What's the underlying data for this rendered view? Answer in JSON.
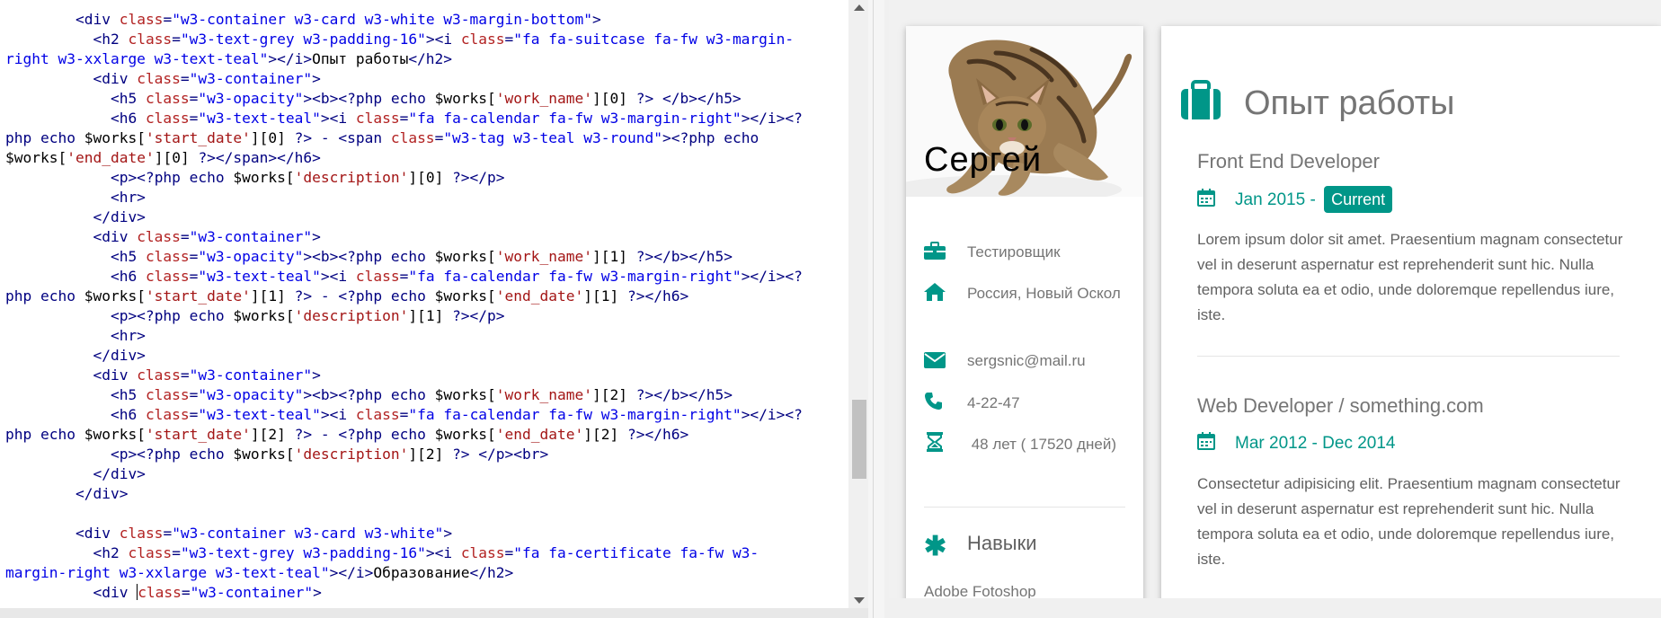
{
  "editor": {
    "lines": [
      [
        {
          "c": "t",
          "v": "        <div "
        },
        {
          "c": "a",
          "v": "class"
        },
        {
          "c": "t",
          "v": "="
        },
        {
          "c": "s",
          "v": "\"w3-container w3-card w3-white w3-margin-bottom\""
        },
        {
          "c": "t",
          "v": ">"
        }
      ],
      [
        {
          "c": "t",
          "v": "          <h2 "
        },
        {
          "c": "a",
          "v": "class"
        },
        {
          "c": "t",
          "v": "="
        },
        {
          "c": "s",
          "v": "\"w3-text-grey w3-padding-16\""
        },
        {
          "c": "t",
          "v": "><i "
        },
        {
          "c": "a",
          "v": "class"
        },
        {
          "c": "t",
          "v": "="
        },
        {
          "c": "s",
          "v": "\"fa fa-suitcase fa-fw w3-margin-"
        }
      ],
      [
        {
          "c": "s",
          "v": "right w3-xxlarge w3-text-teal\""
        },
        {
          "c": "t",
          "v": "></i>"
        },
        {
          "c": "n",
          "v": "Опыт работы"
        },
        {
          "c": "t",
          "v": "</h2>"
        }
      ],
      [
        {
          "c": "t",
          "v": "          <div "
        },
        {
          "c": "a",
          "v": "class"
        },
        {
          "c": "t",
          "v": "="
        },
        {
          "c": "s",
          "v": "\"w3-container\""
        },
        {
          "c": "t",
          "v": ">"
        }
      ],
      [
        {
          "c": "t",
          "v": "            <h5 "
        },
        {
          "c": "a",
          "v": "class"
        },
        {
          "c": "t",
          "v": "="
        },
        {
          "c": "s",
          "v": "\"w3-opacity\""
        },
        {
          "c": "t",
          "v": "><b><?"
        },
        {
          "c": "p",
          "v": "php echo"
        },
        {
          "c": "n",
          "v": " $works["
        },
        {
          "c": "q",
          "v": "'work_name'"
        },
        {
          "c": "n",
          "v": "][0] "
        },
        {
          "c": "t",
          "v": "?> </b></h5>"
        }
      ],
      [
        {
          "c": "t",
          "v": "            <h6 "
        },
        {
          "c": "a",
          "v": "class"
        },
        {
          "c": "t",
          "v": "="
        },
        {
          "c": "s",
          "v": "\"w3-text-teal\""
        },
        {
          "c": "t",
          "v": "><i "
        },
        {
          "c": "a",
          "v": "class"
        },
        {
          "c": "t",
          "v": "="
        },
        {
          "c": "s",
          "v": "\"fa fa-calendar fa-fw w3-margin-right\""
        },
        {
          "c": "t",
          "v": "></i><?"
        }
      ],
      [
        {
          "c": "p",
          "v": "php echo"
        },
        {
          "c": "n",
          "v": " $works["
        },
        {
          "c": "q",
          "v": "'start_date'"
        },
        {
          "c": "n",
          "v": "][0] "
        },
        {
          "c": "t",
          "v": "?> - <span "
        },
        {
          "c": "a",
          "v": "class"
        },
        {
          "c": "t",
          "v": "="
        },
        {
          "c": "s",
          "v": "\"w3-tag w3-teal w3-round\""
        },
        {
          "c": "t",
          "v": "><?"
        },
        {
          "c": "p",
          "v": "php echo"
        }
      ],
      [
        {
          "c": "n",
          "v": "$works["
        },
        {
          "c": "q",
          "v": "'end_date'"
        },
        {
          "c": "n",
          "v": "][0] "
        },
        {
          "c": "t",
          "v": "?></span></h6>"
        }
      ],
      [
        {
          "c": "t",
          "v": "            <p><?"
        },
        {
          "c": "p",
          "v": "php echo"
        },
        {
          "c": "n",
          "v": " $works["
        },
        {
          "c": "q",
          "v": "'description'"
        },
        {
          "c": "n",
          "v": "][0] "
        },
        {
          "c": "t",
          "v": "?></p>"
        }
      ],
      [
        {
          "c": "t",
          "v": "            <hr>"
        }
      ],
      [
        {
          "c": "t",
          "v": "          </div>"
        }
      ],
      [
        {
          "c": "t",
          "v": "          <div "
        },
        {
          "c": "a",
          "v": "class"
        },
        {
          "c": "t",
          "v": "="
        },
        {
          "c": "s",
          "v": "\"w3-container\""
        },
        {
          "c": "t",
          "v": ">"
        }
      ],
      [
        {
          "c": "t",
          "v": "            <h5 "
        },
        {
          "c": "a",
          "v": "class"
        },
        {
          "c": "t",
          "v": "="
        },
        {
          "c": "s",
          "v": "\"w3-opacity\""
        },
        {
          "c": "t",
          "v": "><b><?"
        },
        {
          "c": "p",
          "v": "php echo"
        },
        {
          "c": "n",
          "v": " $works["
        },
        {
          "c": "q",
          "v": "'work_name'"
        },
        {
          "c": "n",
          "v": "][1] "
        },
        {
          "c": "t",
          "v": "?></b></h5>"
        }
      ],
      [
        {
          "c": "t",
          "v": "            <h6 "
        },
        {
          "c": "a",
          "v": "class"
        },
        {
          "c": "t",
          "v": "="
        },
        {
          "c": "s",
          "v": "\"w3-text-teal\""
        },
        {
          "c": "t",
          "v": "><i "
        },
        {
          "c": "a",
          "v": "class"
        },
        {
          "c": "t",
          "v": "="
        },
        {
          "c": "s",
          "v": "\"fa fa-calendar fa-fw w3-margin-right\""
        },
        {
          "c": "t",
          "v": "></i><?"
        }
      ],
      [
        {
          "c": "p",
          "v": "php echo"
        },
        {
          "c": "n",
          "v": " $works["
        },
        {
          "c": "q",
          "v": "'start_date'"
        },
        {
          "c": "n",
          "v": "][1] "
        },
        {
          "c": "t",
          "v": "?> - <?"
        },
        {
          "c": "p",
          "v": "php echo"
        },
        {
          "c": "n",
          "v": " $works["
        },
        {
          "c": "q",
          "v": "'end_date'"
        },
        {
          "c": "n",
          "v": "][1] "
        },
        {
          "c": "t",
          "v": "?></h6>"
        }
      ],
      [
        {
          "c": "t",
          "v": "            <p><?"
        },
        {
          "c": "p",
          "v": "php echo"
        },
        {
          "c": "n",
          "v": " $works["
        },
        {
          "c": "q",
          "v": "'description'"
        },
        {
          "c": "n",
          "v": "][1] "
        },
        {
          "c": "t",
          "v": "?></p>"
        }
      ],
      [
        {
          "c": "t",
          "v": "            <hr>"
        }
      ],
      [
        {
          "c": "t",
          "v": "          </div>"
        }
      ],
      [
        {
          "c": "t",
          "v": "          <div "
        },
        {
          "c": "a",
          "v": "class"
        },
        {
          "c": "t",
          "v": "="
        },
        {
          "c": "s",
          "v": "\"w3-container\""
        },
        {
          "c": "t",
          "v": ">"
        }
      ],
      [
        {
          "c": "t",
          "v": "            <h5 "
        },
        {
          "c": "a",
          "v": "class"
        },
        {
          "c": "t",
          "v": "="
        },
        {
          "c": "s",
          "v": "\"w3-opacity\""
        },
        {
          "c": "t",
          "v": "><b><?"
        },
        {
          "c": "p",
          "v": "php echo"
        },
        {
          "c": "n",
          "v": " $works["
        },
        {
          "c": "q",
          "v": "'work_name'"
        },
        {
          "c": "n",
          "v": "][2] "
        },
        {
          "c": "t",
          "v": "?></b></h5>"
        }
      ],
      [
        {
          "c": "t",
          "v": "            <h6 "
        },
        {
          "c": "a",
          "v": "class"
        },
        {
          "c": "t",
          "v": "="
        },
        {
          "c": "s",
          "v": "\"w3-text-teal\""
        },
        {
          "c": "t",
          "v": "><i "
        },
        {
          "c": "a",
          "v": "class"
        },
        {
          "c": "t",
          "v": "="
        },
        {
          "c": "s",
          "v": "\"fa fa-calendar fa-fw w3-margin-right\""
        },
        {
          "c": "t",
          "v": "></i><?"
        }
      ],
      [
        {
          "c": "p",
          "v": "php echo"
        },
        {
          "c": "n",
          "v": " $works["
        },
        {
          "c": "q",
          "v": "'start_date'"
        },
        {
          "c": "n",
          "v": "][2] "
        },
        {
          "c": "t",
          "v": "?> - <?"
        },
        {
          "c": "p",
          "v": "php echo"
        },
        {
          "c": "n",
          "v": " $works["
        },
        {
          "c": "q",
          "v": "'end_date'"
        },
        {
          "c": "n",
          "v": "][2] "
        },
        {
          "c": "t",
          "v": "?></h6>"
        }
      ],
      [
        {
          "c": "t",
          "v": "            <p><?"
        },
        {
          "c": "p",
          "v": "php echo"
        },
        {
          "c": "n",
          "v": " $works["
        },
        {
          "c": "q",
          "v": "'description'"
        },
        {
          "c": "n",
          "v": "][2] "
        },
        {
          "c": "t",
          "v": "?> </p><br>"
        }
      ],
      [
        {
          "c": "t",
          "v": "          </div>"
        }
      ],
      [
        {
          "c": "t",
          "v": "        </div>"
        }
      ],
      [
        {
          "c": "t",
          "v": ""
        }
      ],
      [
        {
          "c": "t",
          "v": "        <div "
        },
        {
          "c": "a",
          "v": "class"
        },
        {
          "c": "t",
          "v": "="
        },
        {
          "c": "s",
          "v": "\"w3-container w3-card w3-white\""
        },
        {
          "c": "t",
          "v": ">"
        }
      ],
      [
        {
          "c": "t",
          "v": "          <h2 "
        },
        {
          "c": "a",
          "v": "class"
        },
        {
          "c": "t",
          "v": "="
        },
        {
          "c": "s",
          "v": "\"w3-text-grey w3-padding-16\""
        },
        {
          "c": "t",
          "v": "><i "
        },
        {
          "c": "a",
          "v": "class"
        },
        {
          "c": "t",
          "v": "="
        },
        {
          "c": "s",
          "v": "\"fa fa-certificate fa-fw w3-"
        }
      ],
      [
        {
          "c": "s",
          "v": "margin-right w3-xxlarge w3-text-teal\""
        },
        {
          "c": "t",
          "v": "></i>"
        },
        {
          "c": "n",
          "v": "Образование"
        },
        {
          "c": "t",
          "v": "</h2>"
        }
      ],
      [
        {
          "c": "t",
          "v": "          <div "
        },
        {
          "c": "caret",
          "v": ""
        },
        {
          "c": "a",
          "v": "class"
        },
        {
          "c": "t",
          "v": "="
        },
        {
          "c": "s",
          "v": "\"w3-container\""
        },
        {
          "c": "t",
          "v": ">"
        }
      ]
    ]
  },
  "profile": {
    "name": "Сергей",
    "info": [
      {
        "icon": "briefcase-icon",
        "text": "Тестировщик"
      },
      {
        "icon": "home-icon",
        "text": "Россия, Новый Оскол"
      },
      {
        "icon": "envelope-icon",
        "text": "sergsnic@mail.ru"
      },
      {
        "icon": "phone-icon",
        "text": "4-22-47"
      },
      {
        "icon": "hourglass-icon",
        "text": " 48 лет ( 17520 дней)"
      }
    ],
    "skills_heading": "Навыки",
    "skills": [
      {
        "name": "Adobe Fotoshop"
      }
    ]
  },
  "experience": {
    "title": "Опыт работы",
    "jobs": [
      {
        "name": "Front End Developer",
        "start": "Jan 2015 - ",
        "end_tag": "Current",
        "description": "Lorem ipsum dolor sit amet. Praesentium magnam consectetur vel in deserunt aspernatur est reprehenderit sunt hic. Nulla tempora soluta ea et odio, unde doloremque repellendus iure, iste."
      },
      {
        "name": "Web Developer / something.com",
        "dates": "Mar 2012 - Dec 2014",
        "description": "Consectetur adipisicing elit. Praesentium magnam consectetur vel in deserunt aspernatur est reprehenderit sunt hic. Nulla tempora soluta ea et odio, unde doloremque repellendus iure, iste."
      }
    ]
  },
  "colors": {
    "accent": "#009688",
    "text_grey": "#757575",
    "editor_tag": "#000080",
    "editor_attr": "#b22222",
    "editor_string": "#0000e6",
    "editor_php_string": "#a31515"
  }
}
